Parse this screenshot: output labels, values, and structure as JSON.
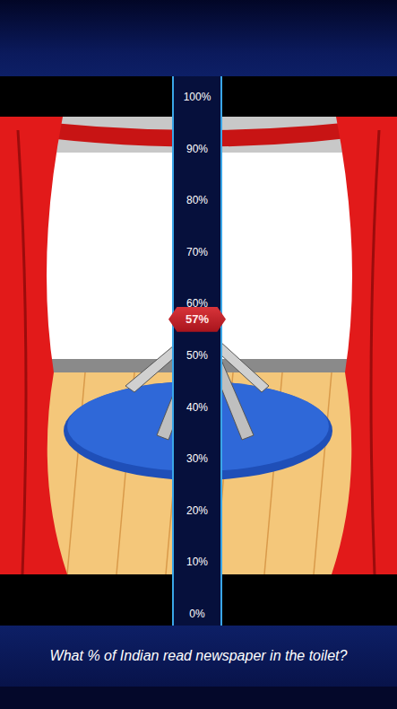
{
  "scale": {
    "ticks": [
      "100%",
      "90%",
      "80%",
      "70%",
      "60%",
      "50%",
      "40%",
      "30%",
      "20%",
      "10%",
      "0%"
    ],
    "marker": {
      "label": "57%",
      "level": 0.57
    }
  },
  "question": "What % of Indian read newspaper in the toilet?"
}
